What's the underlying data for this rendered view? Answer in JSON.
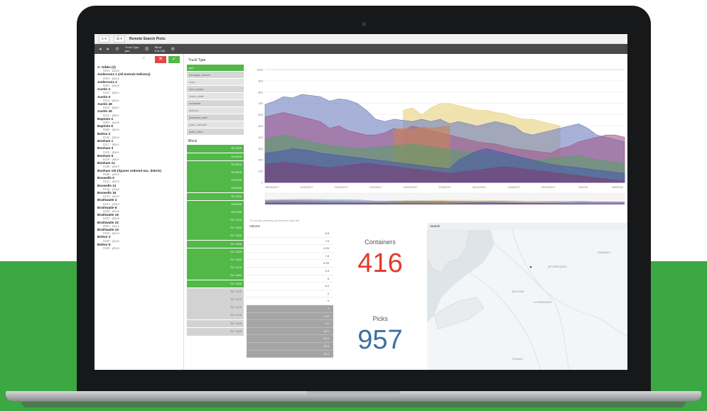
{
  "app": {
    "title": "Remote Search Picks",
    "nav_buttons": [
      "≡ ▾",
      "⊞ ▾"
    ]
  },
  "toolbar": {
    "selections": [
      {
        "label": "Truck Type",
        "value": "pan"
      },
      {
        "label": "Block",
        "value": "5 of 130"
      }
    ]
  },
  "left_panel": {
    "actions": {
      "cancel": "✕",
      "confirm": "✓",
      "search": "⌕"
    },
    "entries": [
      {
        "name": "A. Gibbs (2)",
        "sub": "0001 - place"
      },
      {
        "name": "Andersons 1 (All Instock Delivery)",
        "sub": "0001 - place"
      },
      {
        "name": "Andersons 2",
        "sub": "0001 - place"
      },
      {
        "name": "Austin 2",
        "sub": "0113 - place"
      },
      {
        "name": "Austin 6",
        "sub": "0114 - place"
      },
      {
        "name": "Austin 48",
        "sub": "0115 - place"
      },
      {
        "name": "Austin 26",
        "sub": "0116 - place"
      },
      {
        "name": "Baptiste 4",
        "sub": "0081 - place"
      },
      {
        "name": "Baptiste 8",
        "sub": "0080 - place"
      },
      {
        "name": "Bolton 2",
        "sub": "0102 - place"
      },
      {
        "name": "Bonham 1",
        "sub": "0117 - place"
      },
      {
        "name": "Bonham 3",
        "sub": "0118 - place"
      },
      {
        "name": "Bonham 5",
        "sub": "0119 - place"
      },
      {
        "name": "Bonham 12",
        "sub": "0168 - place"
      },
      {
        "name": "Bonham old (Spares ordered exc. debris)",
        "sub": "0088 - place"
      },
      {
        "name": "Boswells 5",
        "sub": "0141 - place"
      },
      {
        "name": "Boswells 13",
        "sub": "0142 - place"
      },
      {
        "name": "Boswells 16",
        "sub": "0143 - place"
      },
      {
        "name": "Brathwaite 4",
        "sub": "0101 - place"
      },
      {
        "name": "Brathwaite 8",
        "sub": "0100 - place"
      },
      {
        "name": "Brathwaite 16",
        "sub": "0107 - place"
      },
      {
        "name": "Brathwaite 22",
        "sub": "0081 - place"
      },
      {
        "name": "Brathwaite 24",
        "sub": "0104 - place"
      },
      {
        "name": "Bolton 3",
        "sub": "0166 - place"
      },
      {
        "name": "Bolton 8",
        "sub": "0153 - place"
      }
    ]
  },
  "filters": {
    "truck_type": {
      "title": "Truck Type",
      "items": [
        "pan",
        "bandage_stretch",
        "crew",
        "cont_poster",
        "crane_plate",
        "container",
        "delivery",
        "plantaion plate",
        "plate_variable",
        "plate_other"
      ]
    },
    "block": {
      "title": "Block",
      "items": [
        "RC1005",
        "RC2005",
        "RC3005",
        "RC4005",
        "RC5005",
        "RC6005",
        "RC7005",
        "RC8005",
        "RC1035",
        "RC 1015",
        "RC 1025",
        "RC 1035",
        "RC 1045",
        "RC 1055",
        "RC 1065",
        "RC 1075",
        "RC 1085",
        "RC 1095",
        "RC 1105",
        "RC 1115",
        "RC 1125",
        "RC 1135",
        "RC 1145",
        "RC 1155"
      ],
      "selected_count": 18
    }
  },
  "chart_data": {
    "type": "area",
    "title": "",
    "xlabel": "",
    "ylabel": "",
    "ylim": [
      0,
      1000
    ],
    "y_ticks": [
      0,
      100,
      200,
      300,
      400,
      500,
      600,
      700,
      800,
      900,
      1000
    ],
    "x_ticks": [
      "18/09/2017",
      "2/10/2017",
      "11/10/2017",
      "1/10/2017",
      "15/10/2017",
      "1/10/2017",
      "20/11/2017",
      "12/6/2017",
      "23/10/2017",
      "4/24/18",
      "5/8/2018"
    ],
    "legend": "none",
    "grid": true,
    "series": [
      {
        "color": "#e8d07a",
        "values": [
          0,
          0,
          0,
          0,
          0,
          0,
          0,
          0,
          0,
          0,
          0,
          0,
          0,
          0,
          0,
          640,
          660,
          600,
          660,
          700,
          700,
          680,
          660,
          640,
          640,
          620,
          610,
          580,
          560,
          560,
          540,
          520,
          500,
          0,
          0,
          0,
          0,
          0,
          0,
          0
        ]
      },
      {
        "color": "#6e7fbf",
        "values": [
          690,
          720,
          760,
          750,
          780,
          770,
          760,
          720,
          740,
          730,
          700,
          640,
          560,
          540,
          560,
          550,
          540,
          560,
          540,
          560,
          520,
          540,
          520,
          500,
          520,
          540,
          520,
          500,
          440,
          420,
          440,
          460,
          480,
          500,
          520,
          480,
          420,
          400,
          380,
          360
        ]
      },
      {
        "color": "#a05a8e",
        "values": [
          580,
          600,
          620,
          600,
          580,
          560,
          540,
          480,
          500,
          460,
          440,
          420,
          420,
          440,
          480,
          460,
          500,
          480,
          460,
          440,
          420,
          400,
          380,
          360,
          350,
          340,
          320,
          300,
          290,
          280,
          270,
          260,
          300,
          320,
          360,
          380,
          400,
          420,
          420,
          400
        ]
      },
      {
        "color": "#c98452",
        "values": [
          0,
          0,
          0,
          0,
          0,
          0,
          0,
          0,
          0,
          0,
          0,
          0,
          0,
          0,
          470,
          480,
          470,
          490,
          480,
          490,
          500,
          0,
          0,
          0,
          0,
          0,
          0,
          0,
          0,
          0,
          0,
          0,
          0,
          0,
          0,
          0,
          0,
          0,
          0,
          0
        ]
      },
      {
        "color": "#5a9e6a",
        "values": [
          380,
          400,
          420,
          400,
          380,
          360,
          340,
          330,
          320,
          310,
          300,
          300,
          310,
          320,
          330,
          330,
          340,
          330,
          320,
          300,
          290,
          280,
          270,
          260,
          250,
          240,
          230,
          220,
          210,
          200,
          200,
          210,
          220,
          230,
          240,
          220,
          200,
          190,
          180,
          170
        ]
      },
      {
        "color": "#4a5aa8",
        "values": [
          260,
          270,
          280,
          300,
          290,
          280,
          260,
          250,
          240,
          230,
          220,
          210,
          200,
          190,
          180,
          170,
          160,
          150,
          140,
          130,
          120,
          200,
          240,
          280,
          300,
          280,
          260,
          240,
          220,
          200,
          180,
          160,
          150,
          140,
          130,
          120,
          110,
          100,
          90,
          80
        ]
      },
      {
        "color": "#7a3e7a",
        "values": [
          160,
          170,
          180,
          170,
          160,
          150,
          140,
          130,
          140,
          150,
          160,
          170,
          160,
          150,
          140,
          130,
          120,
          110,
          100,
          90,
          80,
          90,
          100,
          110,
          120,
          130,
          140,
          130,
          120,
          110,
          100,
          90,
          80,
          70,
          60,
          50,
          40,
          30,
          20,
          10
        ]
      }
    ]
  },
  "chart_footnote": "*Currently showing all selected data set",
  "bottom_left": {
    "title": "Volume",
    "rows": [
      "8.8",
      "7.6",
      "6.26",
      "7.8",
      "6.95",
      "9.8",
      "8",
      "8.4",
      "4",
      "9",
      "4",
      "9.03",
      "9.0",
      "48.0",
      "49.8",
      "49.8",
      "48.0"
    ],
    "gray_from": 10
  },
  "kpis": {
    "containers": {
      "label": "Containers",
      "value": "416",
      "color": "#e53a2b"
    },
    "picks": {
      "label": "Picks",
      "value": "957",
      "color": "#3e6fa3"
    }
  },
  "map": {
    "title": "Stands",
    "labels": [
      "GERMANY",
      "FRANCE",
      "BELGIUM",
      "LUXEMBOURG",
      "NETHERLANDS"
    ]
  }
}
